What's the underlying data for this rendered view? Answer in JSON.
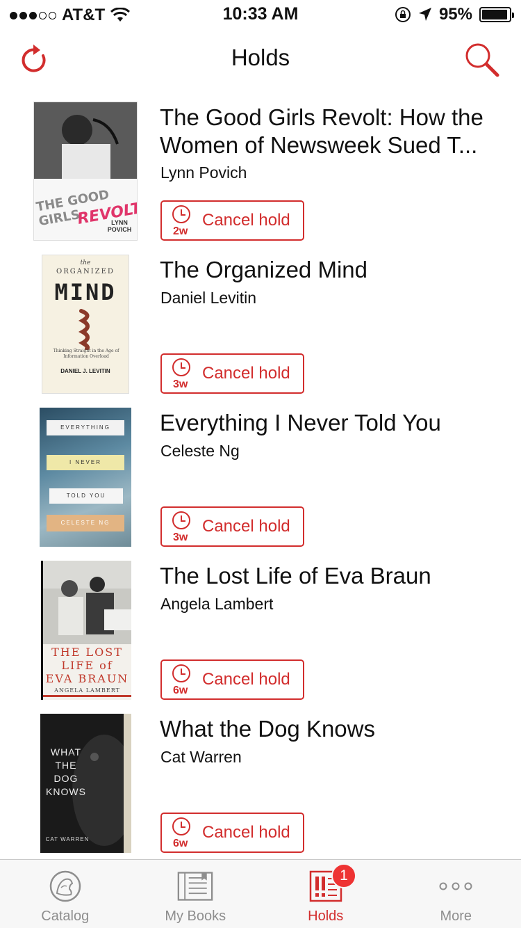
{
  "status_bar": {
    "carrier": "AT&T",
    "time": "10:33 AM",
    "battery": "95%",
    "battery_level": 0.95,
    "signal_bars_filled": 3,
    "signal_bars_total": 5
  },
  "nav": {
    "title": "Holds",
    "refresh_icon": "refresh-icon",
    "search_icon": "search-icon"
  },
  "colors": {
    "accent": "#d22d2d",
    "tab_inactive": "#8e8e8e"
  },
  "holds": [
    {
      "title": "The Good Girls Revolt: How the Women of Newsweek Sued T...",
      "author": "Lynn Povich",
      "wait": "2w",
      "button": "Cancel hold"
    },
    {
      "title": "The Organized Mind",
      "author": "Daniel Levitin",
      "wait": "3w",
      "button": "Cancel hold"
    },
    {
      "title": "Everything I Never Told You",
      "author": "Celeste Ng",
      "wait": "3w",
      "button": "Cancel hold"
    },
    {
      "title": "The Lost Life of Eva Braun",
      "author": "Angela Lambert",
      "wait": "6w",
      "button": "Cancel hold"
    },
    {
      "title": "What the Dog Knows",
      "author": "Cat Warren",
      "wait": "6w",
      "button": "Cancel hold"
    }
  ],
  "covers": {
    "c1": {
      "line1": "THE GOOD GIRLS",
      "line2": "REVOLT",
      "author": "LYNN POVICH"
    },
    "c2": {
      "the": "the",
      "organized": "ORGANIZED",
      "mind": "MIND",
      "sub": "Thinking Straight in the Age of Information Overload",
      "author": "DANIEL J. LEVITIN"
    },
    "c3": {
      "l1": "EVERYTHING",
      "l2": "I NEVER",
      "l3": "TOLD YOU",
      "l4": "CELESTE NG"
    },
    "c4": {
      "l1": "THE LOST",
      "l2": "LIFE of",
      "l3": "EVA BRAUN",
      "author": "ANGELA LAMBERT"
    },
    "c5": {
      "l1": "WHAT",
      "l2": "THE",
      "l3": "DOG",
      "l4": "KNOWS",
      "author": "CAT WARREN"
    }
  },
  "tabs": [
    {
      "label": "Catalog",
      "icon": "catalog-icon",
      "active": false
    },
    {
      "label": "My Books",
      "icon": "my-books-icon",
      "active": false
    },
    {
      "label": "Holds",
      "icon": "holds-icon",
      "active": true,
      "badge": "1"
    },
    {
      "label": "More",
      "icon": "more-icon",
      "active": false
    }
  ]
}
